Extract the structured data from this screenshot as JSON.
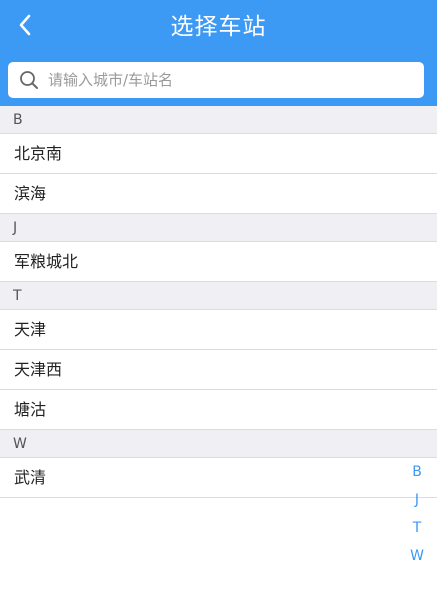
{
  "header": {
    "title": "选择车站",
    "back_icon": "chevron-left-icon",
    "background_color": "#3c99f4"
  },
  "search": {
    "placeholder": "请输入城市/车站名",
    "value": "",
    "icon": "search-icon"
  },
  "sections": [
    {
      "letter": "B",
      "stations": [
        "北京南",
        "滨海"
      ]
    },
    {
      "letter": "J",
      "stations": [
        "军粮城北"
      ]
    },
    {
      "letter": "T",
      "stations": [
        "天津",
        "天津西",
        "塘沽"
      ]
    },
    {
      "letter": "W",
      "stations": [
        "武清"
      ]
    }
  ],
  "index_bar": [
    "B",
    "J",
    "T",
    "W"
  ]
}
